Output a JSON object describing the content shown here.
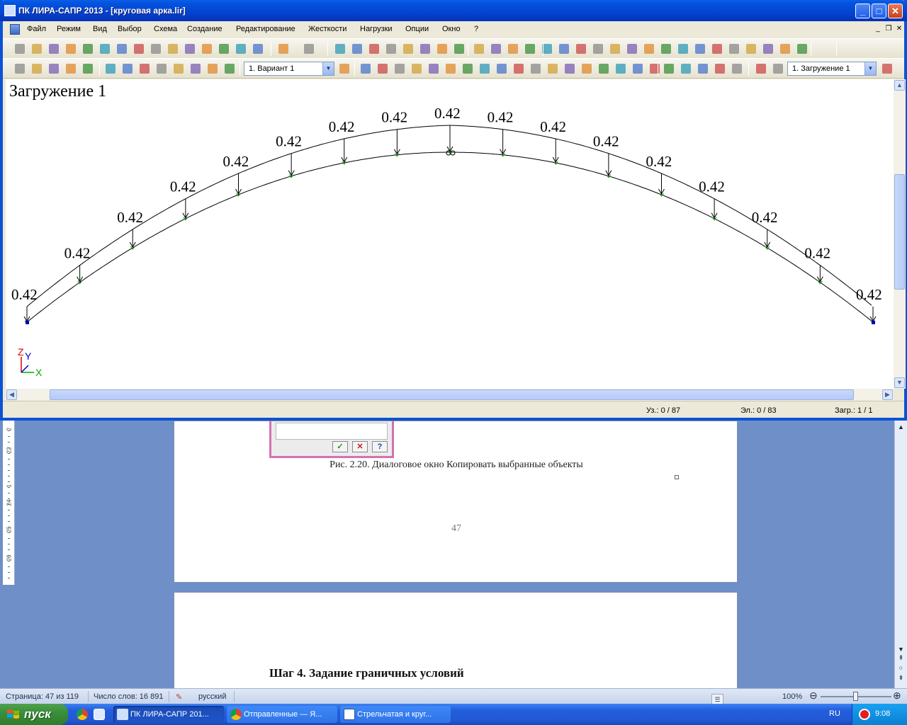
{
  "window": {
    "title": "ПК ЛИРА-САПР  2013 - [круговая арка.lir]"
  },
  "menu": {
    "items": [
      "Файл",
      "Режим",
      "Вид",
      "Выбор",
      "Схема",
      "Создание",
      "Редактирование",
      "Жесткости",
      "Нагрузки",
      "Опции",
      "Окно",
      "?"
    ]
  },
  "toolbar": {
    "variant_combo": "1. Вариант 1",
    "load_case_combo": "1. Загружение 1"
  },
  "canvas": {
    "title": "Загружение 1",
    "load_labels": [
      "0.42",
      "0.42",
      "0.42",
      "0.42",
      "0.42",
      "0.42",
      "0.42",
      "0.42",
      "0.42",
      "0.42",
      "0.42",
      "0.42",
      "0.42",
      "0.42",
      "0.42",
      "0.42",
      "0.42"
    ],
    "axis_labels": {
      "z": "Z",
      "y": "Y",
      "x": "X"
    }
  },
  "lira_status": {
    "nodes": "Уз.: 0 / 87",
    "elements": "Эл.: 0 / 83",
    "load": "Загр.: 1 / 1"
  },
  "word": {
    "caption": "Рис. 2.20. Диалоговое окно Копировать выбранные объекты",
    "page_number": "47",
    "heading": "Шаг 4. Задание граничных условий",
    "ruler_numbers": [
      "2",
      "22",
      "1",
      "24",
      "25",
      "26"
    ],
    "status": {
      "page": "Страница: 47 из 119",
      "words": "Число слов: 16 891",
      "language": "русский",
      "zoom": "100%"
    }
  },
  "dialog_fragment": {
    "ok_glyph": "✓",
    "cancel_glyph": "✕",
    "help_glyph": "?"
  },
  "taskbar": {
    "start": "пуск",
    "items": [
      {
        "label": "ПК ЛИРА-САПР 201...",
        "active": true
      },
      {
        "label": "Отправленные — Я...",
        "active": false
      },
      {
        "label": "Стрельчатая и круг...",
        "active": false
      }
    ],
    "language": "RU",
    "clock": "9:08"
  },
  "colors": {
    "title_bar": "#0453de",
    "load_arrows": "#000000",
    "node_marks": "#00a000",
    "support_nodes": "#0000c0"
  }
}
